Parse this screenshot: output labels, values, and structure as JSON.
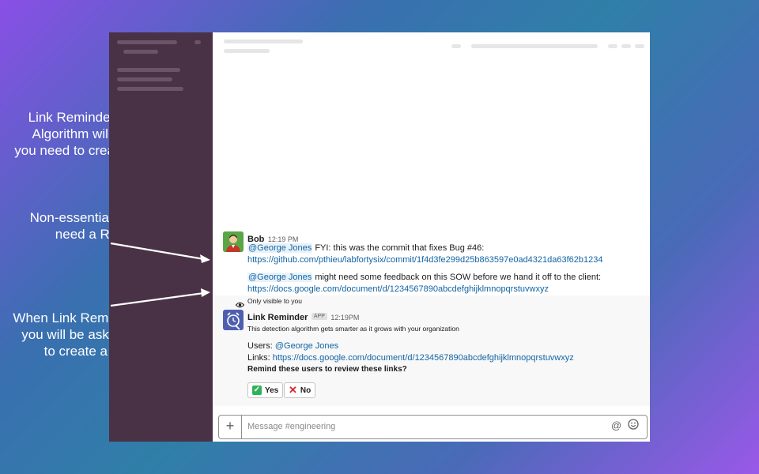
{
  "annotations": {
    "detection": [
      "Link Reminder’s Detection",
      "Algorithm will figure out if",
      "you need to create a Reminder"
    ],
    "non_essential": [
      "Non-essential links do not",
      "need a Reminder"
    ],
    "unsure": [
      "When Link Reminder is unsure,",
      "you will be asked if you want",
      "to create a Reminder"
    ]
  },
  "messages": {
    "bob": {
      "name": "Bob",
      "time": "12:19 PM",
      "m1_mention": "@George Jones",
      "m1_text": " FYI: this was the commit that fixes Bug #46:",
      "m1_link": "https://github.com/pthieu/labfortysix/commit/1f4d3fe299d25b863597e0ad4321da63f62b1234",
      "m2_mention": "@George Jones",
      "m2_text": " might need some feedback on this SOW before we hand it off to the client:",
      "m2_link": "https://docs.google.com/document/d/1234567890abcdefghijklmnopqrstuvwxyz"
    },
    "app": {
      "visibility": "Only visible to you",
      "name": "Link Reminder",
      "badge": "APP",
      "time": "12:19PM",
      "description": "This detection algorithm gets smarter as it grows with your organization",
      "users_label": "Users: ",
      "users_value": "@George Jones",
      "links_label": "Links: ",
      "links_value": "https://docs.google.com/document/d/1234567890abcdefghijklmnopqrstuvwxyz",
      "question": "Remind these users to review these links?",
      "yes_label": "Yes",
      "no_label": "No"
    }
  },
  "composer": {
    "placeholder": "Message #engineering"
  },
  "icons": {
    "plus": "plus-icon",
    "at": "at-icon",
    "emoji": "emoji-icon",
    "eye": "eye-icon",
    "check": "check-icon",
    "x": "x-icon"
  }
}
